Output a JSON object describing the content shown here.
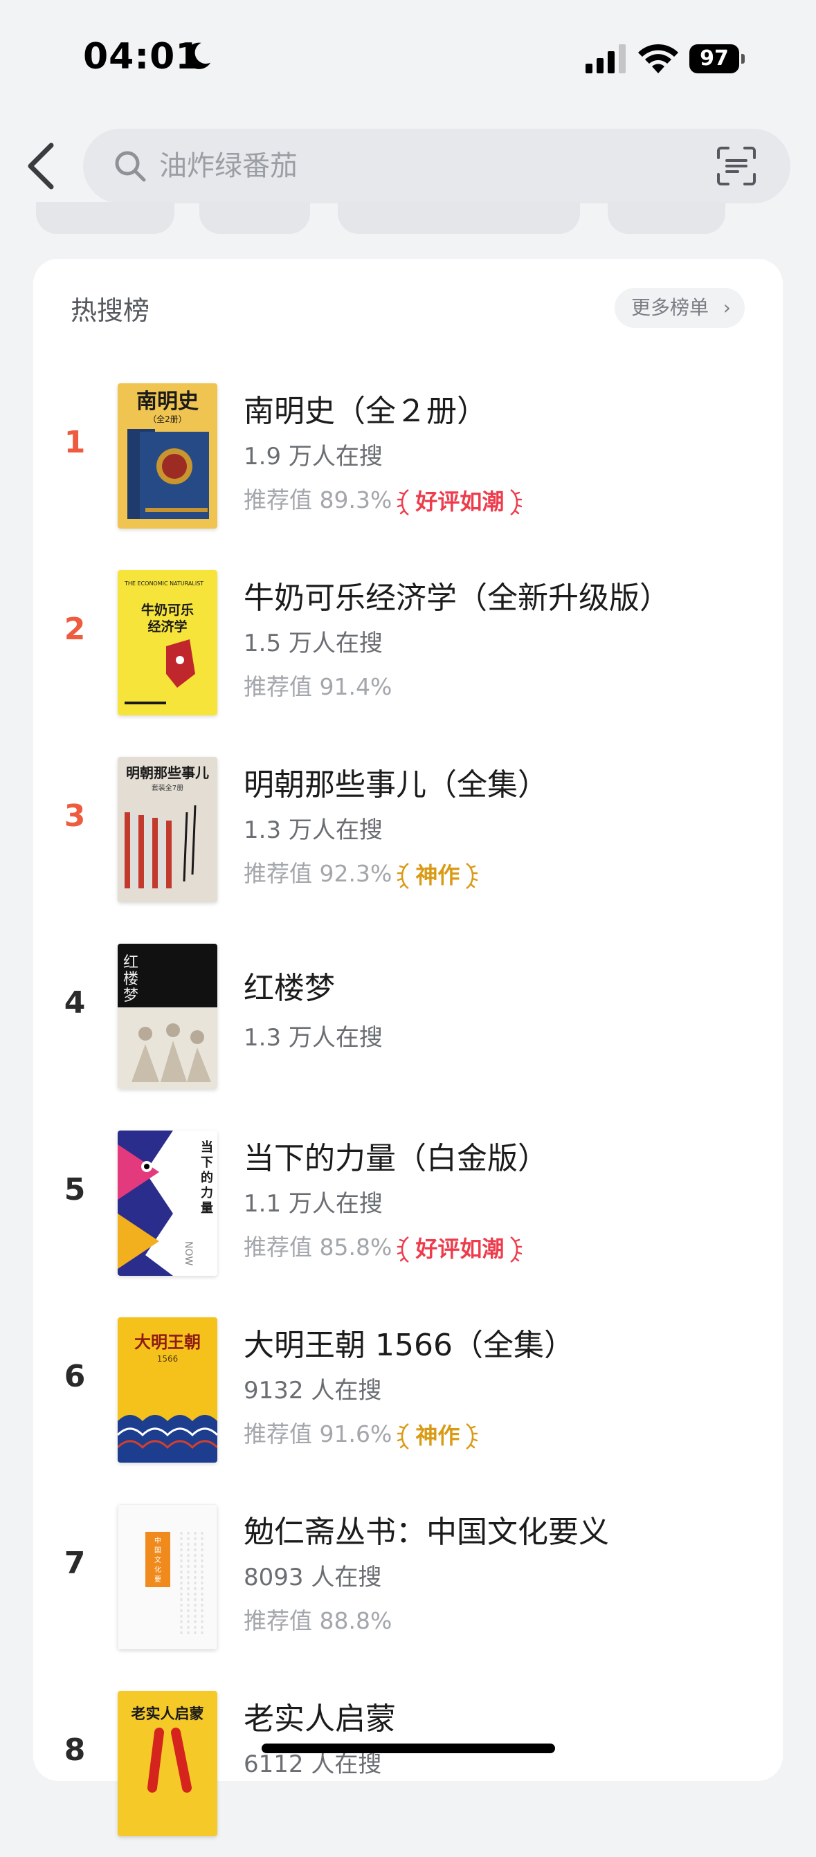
{
  "status_bar": {
    "time": "04:01",
    "battery": "97"
  },
  "search": {
    "placeholder": "油炸绿番茄"
  },
  "hot_list": {
    "title": "热搜榜",
    "more_label": "更多榜单",
    "items": [
      {
        "rank": "1",
        "title": "南明史（全２册）",
        "searchers": "1.9 万人在搜",
        "rec": "推荐值 89.3%",
        "badge": "好评如潮",
        "badge_color": "#ee3c4c",
        "cover_title": "南明史",
        "cover_sub": "（全2册）"
      },
      {
        "rank": "2",
        "title": "牛奶可乐经济学（全新升级版）",
        "searchers": "1.5 万人在搜",
        "rec": "推荐值 91.4%",
        "badge": "",
        "cover_title": "牛奶可乐经济学",
        "cover_sub": "THE ECONOMIC NATURALIST"
      },
      {
        "rank": "3",
        "title": "明朝那些事儿（全集）",
        "searchers": "1.3 万人在搜",
        "rec": "推荐值 92.3%",
        "badge": "神作",
        "badge_color": "#d99a14",
        "cover_title": "明朝那些事儿",
        "cover_sub": "套装全7册"
      },
      {
        "rank": "4",
        "title": "红楼梦",
        "searchers": "1.3 万人在搜",
        "rec": "",
        "badge": "",
        "cover_title": "红楼梦",
        "cover_sub": ""
      },
      {
        "rank": "5",
        "title": "当下的力量（白金版）",
        "searchers": "1.1 万人在搜",
        "rec": "推荐值 85.8%",
        "badge": "好评如潮",
        "badge_color": "#ee3c4c",
        "cover_title": "当下的力量",
        "cover_sub": "NOW"
      },
      {
        "rank": "6",
        "title": "大明王朝 1566（全集）",
        "searchers": "9132 人在搜",
        "rec": "推荐值 91.6%",
        "badge": "神作",
        "badge_color": "#d99a14",
        "cover_title": "大明王朝",
        "cover_sub": "1566"
      },
      {
        "rank": "7",
        "title": "勉仁斋丛书：中国文化要义",
        "searchers": "8093 人在搜",
        "rec": "推荐值 88.8%",
        "badge": "",
        "cover_title": "中国文化要义",
        "cover_sub": ""
      },
      {
        "rank": "8",
        "title": "老实人启蒙",
        "searchers": "6112 人在搜",
        "rec": "",
        "badge": "",
        "cover_title": "老实人启蒙",
        "cover_sub": ""
      }
    ]
  },
  "colors": {
    "top_rank": "#ee5b3f",
    "badge_red": "#ee3c4c",
    "badge_gold": "#d99a14"
  }
}
